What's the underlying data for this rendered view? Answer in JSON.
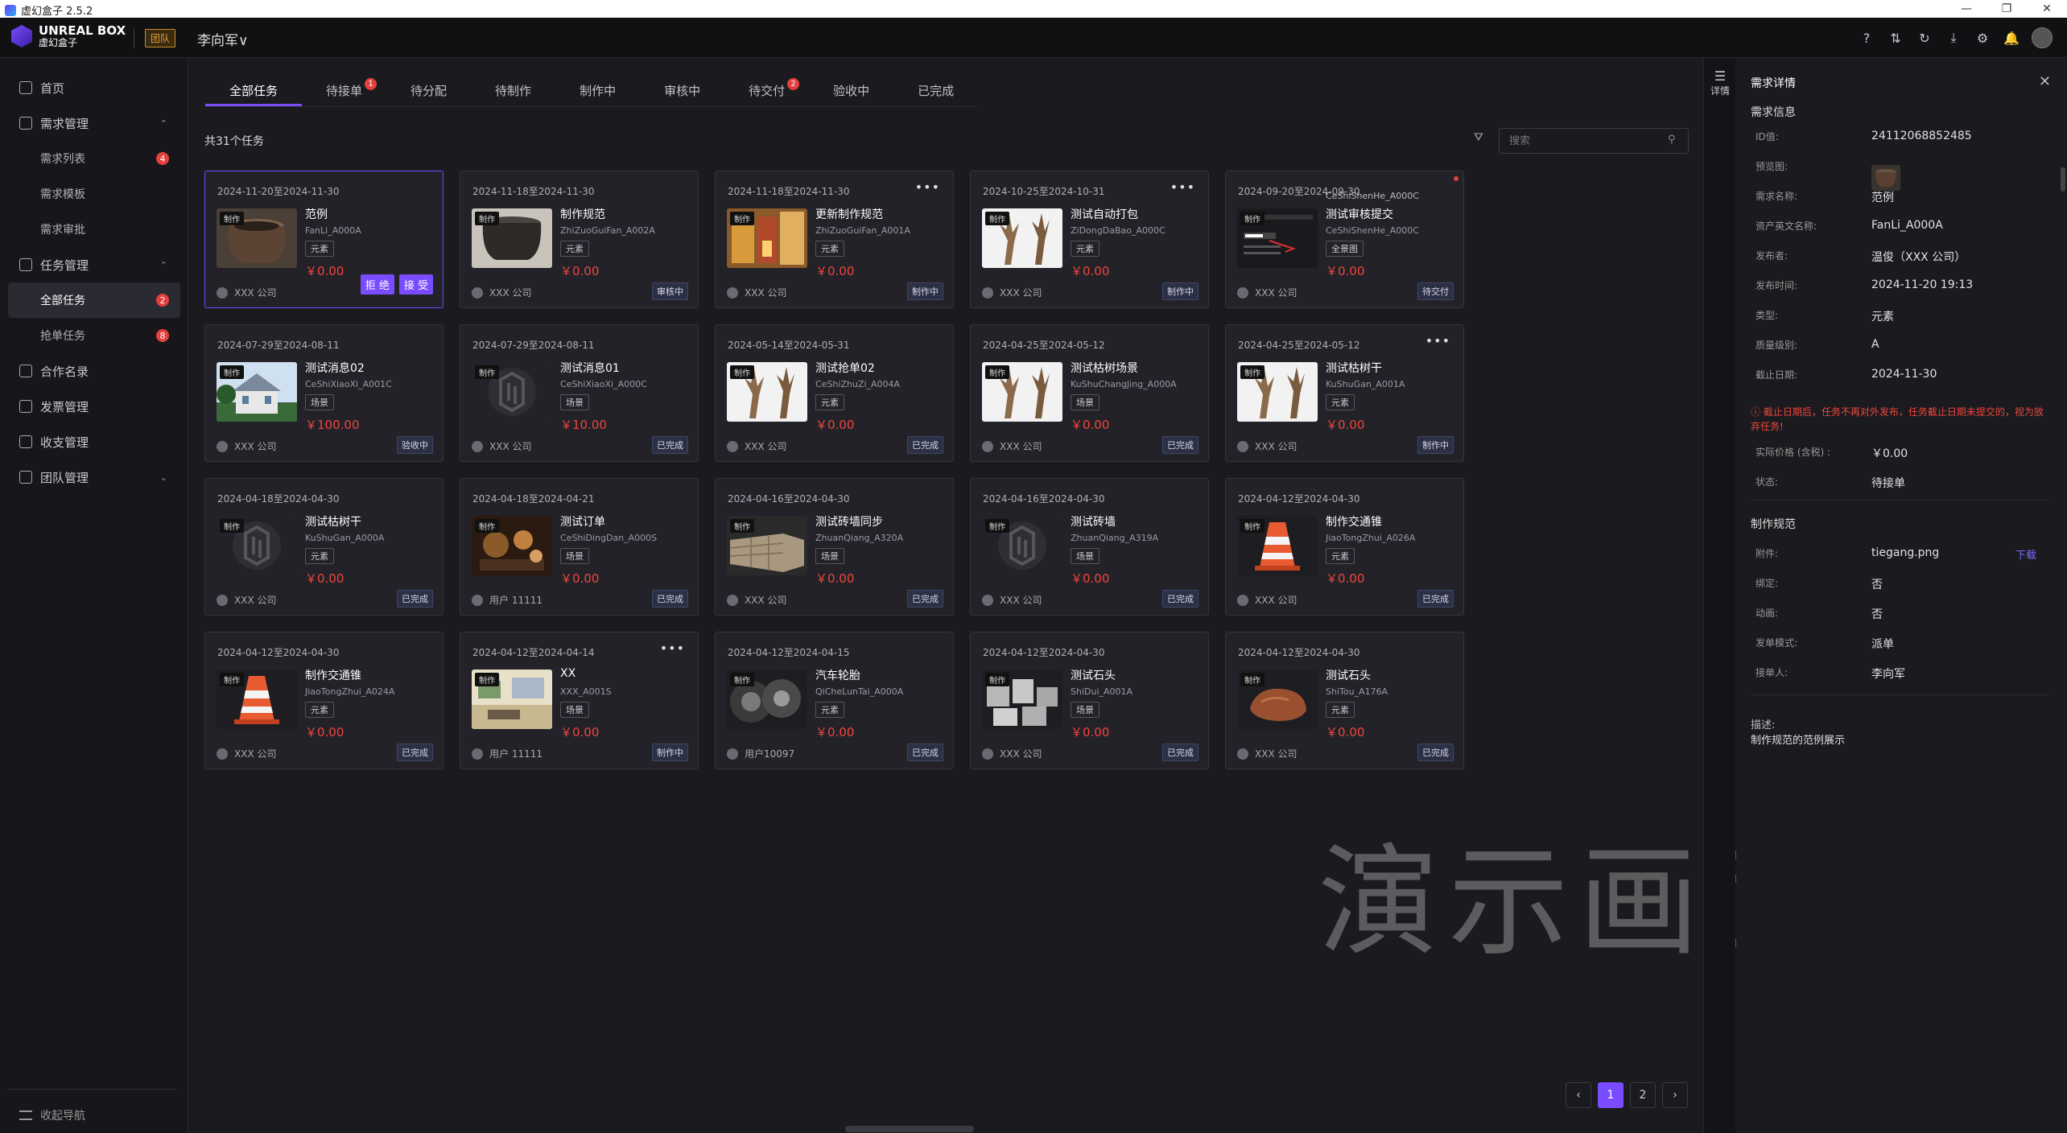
{
  "window": {
    "title": "虚幻盒子 2.5.2",
    "controls": [
      "—",
      "❐",
      "✕"
    ]
  },
  "header": {
    "logo_line1": "UNREAL BOX",
    "logo_line2": "虚幻盒子",
    "team_badge": "团队",
    "user": "李向军∨",
    "icons": [
      "help-icon",
      "transfer-icon",
      "refresh-icon",
      "download-icon",
      "settings-icon",
      "bell-icon"
    ]
  },
  "sidebar": {
    "items": [
      {
        "label": "首页",
        "type": "top"
      },
      {
        "label": "需求管理",
        "type": "top",
        "chev": "⌃"
      },
      {
        "label": "需求列表",
        "type": "sub",
        "badge": "4"
      },
      {
        "label": "需求模板",
        "type": "sub"
      },
      {
        "label": "需求审批",
        "type": "sub"
      },
      {
        "label": "任务管理",
        "type": "top",
        "chev": "⌃"
      },
      {
        "label": "全部任务",
        "type": "sub",
        "badge": "2",
        "active": true
      },
      {
        "label": "抢单任务",
        "type": "sub",
        "badge": "8"
      },
      {
        "label": "合作名录",
        "type": "top"
      },
      {
        "label": "发票管理",
        "type": "top"
      },
      {
        "label": "收支管理",
        "type": "top"
      },
      {
        "label": "团队管理",
        "type": "top",
        "chev": "⌄"
      }
    ],
    "collapse_label": "收起导航"
  },
  "tabs": [
    {
      "label": "全部任务",
      "active": true
    },
    {
      "label": "待接单",
      "badge": "1"
    },
    {
      "label": "待分配"
    },
    {
      "label": "待制作"
    },
    {
      "label": "制作中"
    },
    {
      "label": "审核中"
    },
    {
      "label": "待交付",
      "badge": "2"
    },
    {
      "label": "验收中"
    },
    {
      "label": "已完成"
    }
  ],
  "toolbar": {
    "total": "共31个任务",
    "search_placeholder": "搜索"
  },
  "cards": [
    {
      "date": "2024-11-20至2024-11-30",
      "tag": "制作",
      "name": "范例",
      "code": "FanLi_A000A",
      "type": "元素",
      "price": "￥0.00",
      "owner": "XXX 公司",
      "actions": [
        "拒 绝",
        "接 受"
      ],
      "thumb": "pot"
    },
    {
      "date": "2024-11-18至2024-11-30",
      "tag": "制作",
      "name": "制作规范",
      "code": "ZhiZuoGuiFan_A002A",
      "type": "元素",
      "price": "￥0.00",
      "owner": "XXX 公司",
      "status": "审核中",
      "thumb": "pot2"
    },
    {
      "date": "2024-11-18至2024-11-30",
      "more": "•••",
      "tag": "制作",
      "name": "更新制作规范",
      "code": "ZhiZuoGuiFan_A001A",
      "type": "元素",
      "price": "￥0.00",
      "owner": "XXX 公司",
      "status": "制作中",
      "thumb": "shop"
    },
    {
      "date": "2024-10-25至2024-10-31",
      "more": "•••",
      "tag": "制作",
      "name": "测试自动打包",
      "code": "ZiDongDaBao_A000C",
      "type": "元素",
      "price": "￥0.00",
      "owner": "XXX 公司",
      "status": "制作中",
      "thumb": "trees"
    },
    {
      "date": "2024-09-20至2024-09-30",
      "dot": true,
      "tag": "制作",
      "name": "测试审核提交",
      "overlay": "CeShiShenHe_A000C",
      "code": "CeShiShenHe_A000C",
      "type": "全景图",
      "price": "￥0.00",
      "owner": "XXX 公司",
      "status": "待交付",
      "thumb": "ui"
    },
    {
      "date": "2024-07-29至2024-08-11",
      "tag": "制作",
      "name": "测试消息02",
      "code": "CeShiXiaoXi_A001C",
      "type": "场景",
      "price": "￥100.00",
      "owner": "XXX 公司",
      "status": "验收中",
      "thumb": "house"
    },
    {
      "date": "2024-07-29至2024-08-11",
      "tag": "制作",
      "name": "测试消息01",
      "code": "CeShiXiaoXi_A000C",
      "type": "场景",
      "price": "￥10.00",
      "owner": "XXX 公司",
      "status": "已完成",
      "thumb": "logo"
    },
    {
      "date": "2024-05-14至2024-05-31",
      "tag": "制作",
      "name": "测试抢单02",
      "code": "CeShiZhuZi_A004A",
      "type": "元素",
      "price": "￥0.00",
      "owner": "XXX 公司",
      "status": "已完成",
      "thumb": "trees"
    },
    {
      "date": "2024-04-25至2024-05-12",
      "tag": "制作",
      "name": "测试枯树场景",
      "code": "KuShuChangJing_A000A",
      "type": "场景",
      "price": "￥0.00",
      "owner": "XXX 公司",
      "status": "已完成",
      "thumb": "trees"
    },
    {
      "date": "2024-04-25至2024-05-12",
      "more": "•••",
      "tag": "制作",
      "name": "测试枯树干",
      "code": "KuShuGan_A001A",
      "type": "元素",
      "price": "￥0.00",
      "owner": "XXX 公司",
      "status": "制作中",
      "thumb": "trees"
    },
    {
      "date": "2024-04-18至2024-04-30",
      "tag": "制作",
      "name": "测试枯树干",
      "code": "KuShuGan_A000A",
      "type": "元素",
      "price": "￥0.00",
      "owner": "XXX 公司",
      "status": "已完成",
      "thumb": "logo"
    },
    {
      "date": "2024-04-18至2024-04-21",
      "tag": "制作",
      "name": "测试订单",
      "code": "CeShiDingDan_A000S",
      "type": "场景",
      "price": "￥0.00",
      "owner": "用户 11111",
      "status": "已完成",
      "thumb": "dark"
    },
    {
      "date": "2024-04-16至2024-04-30",
      "tag": "制作",
      "name": "测试砖墙同步",
      "code": "ZhuanQiang_A320A",
      "type": "场景",
      "price": "￥0.00",
      "owner": "XXX 公司",
      "status": "已完成",
      "thumb": "wall"
    },
    {
      "date": "2024-04-16至2024-04-30",
      "tag": "制作",
      "name": "测试砖墙",
      "code": "ZhuanQiang_A319A",
      "type": "场景",
      "price": "￥0.00",
      "owner": "XXX 公司",
      "status": "已完成",
      "thumb": "logo"
    },
    {
      "date": "2024-04-12至2024-04-30",
      "tag": "制作",
      "name": "制作交通锥",
      "code": "JiaoTongZhui_A026A",
      "type": "元素",
      "price": "￥0.00",
      "owner": "XXX 公司",
      "status": "已完成",
      "thumb": "cone"
    },
    {
      "date": "2024-04-12至2024-04-30",
      "tag": "制作",
      "name": "制作交通锥",
      "code": "JiaoTongZhui_A024A",
      "type": "元素",
      "price": "￥0.00",
      "owner": "XXX 公司",
      "status": "已完成",
      "thumb": "cone"
    },
    {
      "date": "2024-04-12至2024-04-14",
      "more": "•••",
      "tag": "制作",
      "name": "XX",
      "code": "XXX_A001S",
      "type": "场景",
      "price": "￥0.00",
      "owner": "用户 11111",
      "status": "制作中",
      "thumb": "room"
    },
    {
      "date": "2024-04-12至2024-04-15",
      "tag": "制作",
      "name": "汽车轮胎",
      "code": "QiCheLunTai_A000A",
      "type": "元素",
      "price": "￥0.00",
      "owner": "用户10097",
      "status": "已完成",
      "thumb": "tire"
    },
    {
      "date": "2024-04-12至2024-04-30",
      "tag": "制作",
      "name": "测试石头",
      "code": "ShiDui_A001A",
      "type": "场景",
      "price": "￥0.00",
      "owner": "XXX 公司",
      "status": "已完成",
      "thumb": "stones"
    },
    {
      "date": "2024-04-12至2024-04-30",
      "tag": "制作",
      "name": "测试石头",
      "code": "ShiTou_A176A",
      "type": "元素",
      "price": "￥0.00",
      "owner": "XXX 公司",
      "status": "已完成",
      "thumb": "rock"
    }
  ],
  "pagination": {
    "prev": "‹",
    "pages": [
      "1",
      "2"
    ],
    "current": "1",
    "next": "›"
  },
  "watermark": "演示画面",
  "detail_strip": "详情",
  "panel": {
    "title": "需求详情",
    "close": "✕",
    "info_section": "需求信息",
    "fields": [
      {
        "label": "ID值:",
        "value": "24112068852485"
      },
      {
        "label": "预览图:",
        "value": ""
      },
      {
        "label": "需求名称:",
        "value": "范例"
      },
      {
        "label": "资产英文名称:",
        "value": "FanLi_A000A"
      },
      {
        "label": "发布者:",
        "value": "温俊（XXX 公司）"
      },
      {
        "label": "发布时间:",
        "value": "2024-11-20 19:13"
      },
      {
        "label": "类型:",
        "value": "元素"
      },
      {
        "label": "质量级别:",
        "value": "A"
      },
      {
        "label": "截止日期:",
        "value": "2024-11-30"
      }
    ],
    "warning": "ⓘ 截止日期后，任务不再对外发布，任务截止日期未提交的，视为放弃任务!",
    "fields2": [
      {
        "label": "实际价格 (含税) :",
        "value": "￥0.00"
      },
      {
        "label": "状态:",
        "value": "待接单"
      }
    ],
    "spec_section": "制作规范",
    "fields3": [
      {
        "label": "附件:",
        "value": "tiegang.png"
      },
      {
        "label": "绑定:",
        "value": "否"
      },
      {
        "label": "动画:",
        "value": "否"
      },
      {
        "label": "发单模式:",
        "value": "派单"
      },
      {
        "label": "接单人:",
        "value": "李向军"
      }
    ],
    "download": "下载",
    "desc_label": "描述:",
    "desc": "制作规范的范例展示"
  }
}
